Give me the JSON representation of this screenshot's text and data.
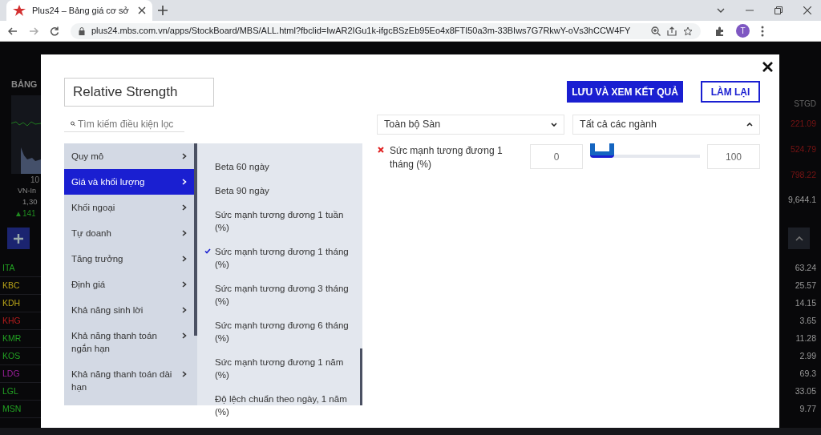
{
  "browser": {
    "tab_title": "Plus24 – Bảng giá cơ sở",
    "url": "plus24.mbs.com.vn/apps/StockBoard/MBS/ALL.html?fbclid=IwAR2IGu1k-ifgcBSzEb95Eo4x8FTI50a3m-33BIws7G7RkwY-oVs3hCCW4FY",
    "profile_initial": "T"
  },
  "board": {
    "title": "BẢNG",
    "axis_label": "10",
    "index_name": "VN-In",
    "index_value": "1,30",
    "index_change": "▲141",
    "column_header": "STGD",
    "stats": [
      {
        "text": "221.09",
        "color": "#7a1414"
      },
      {
        "text": "524.79",
        "color": "#7a1414"
      },
      {
        "text": "798.22",
        "color": "#7a1414"
      },
      {
        "text": "9,644.1",
        "color": "#9a9a9a"
      }
    ],
    "rows": [
      {
        "code": "ITA",
        "color": "#22a022",
        "value": "63.24"
      },
      {
        "code": "KBC",
        "color": "#b5a018",
        "value": "25.57"
      },
      {
        "code": "KDH",
        "color": "#b5a018",
        "value": "14.15"
      },
      {
        "code": "KHG",
        "color": "#b01c1c",
        "value": "3.65"
      },
      {
        "code": "KMR",
        "color": "#22a022",
        "value": "11.28"
      },
      {
        "code": "KOS",
        "color": "#22a022",
        "value": "2.99"
      },
      {
        "code": "LDG",
        "color": "#9a1f9a",
        "value": "69.3"
      },
      {
        "code": "LGL",
        "color": "#22a022",
        "value": "33.05"
      },
      {
        "code": "MSN",
        "color": "#22a022",
        "value": "9.77"
      }
    ]
  },
  "modal": {
    "name_field": "Relative Strength",
    "search_placeholder": "Tìm kiếm điều kiện lọc",
    "categories": [
      {
        "label": "Quy mô",
        "selected": false
      },
      {
        "label": "Giá và khối lượng",
        "selected": true
      },
      {
        "label": "Khối ngoại",
        "selected": false
      },
      {
        "label": "Tự doanh",
        "selected": false
      },
      {
        "label": "Tăng trưởng",
        "selected": false
      },
      {
        "label": "Định giá",
        "selected": false
      },
      {
        "label": "Khả năng sinh lời",
        "selected": false
      },
      {
        "label": "Khả năng thanh toán ngắn hạn",
        "selected": false
      },
      {
        "label": "Khả năng thanh toán dài hạn",
        "selected": false
      }
    ],
    "criteria": [
      {
        "label": "Beta 60 ngày",
        "checked": false
      },
      {
        "label": "Beta 90 ngày",
        "checked": false
      },
      {
        "label": "Sức mạnh tương đương 1 tuần (%)",
        "checked": false
      },
      {
        "label": "Sức mạnh tương đương 1 tháng (%)",
        "checked": true
      },
      {
        "label": "Sức mạnh tương đương 3 tháng (%)",
        "checked": false
      },
      {
        "label": "Sức mạnh tương đương 6 tháng (%)",
        "checked": false
      },
      {
        "label": "Sức mạnh tương đương 1 năm (%)",
        "checked": false
      },
      {
        "label": "Độ lệch chuẩn theo ngày, 1 năm (%)",
        "checked": false
      }
    ],
    "save_button": "LƯU VÀ XEM KẾT QUẢ",
    "reset_button": "LÀM LẠI",
    "selects": [
      {
        "value": "Toàn bộ Sàn",
        "expanded": false
      },
      {
        "value": "Tất cả các ngành",
        "expanded": true
      }
    ],
    "filters": [
      {
        "label": "Sức mạnh tương đương 1 tháng (%)",
        "min": "0",
        "max": "100"
      }
    ]
  }
}
